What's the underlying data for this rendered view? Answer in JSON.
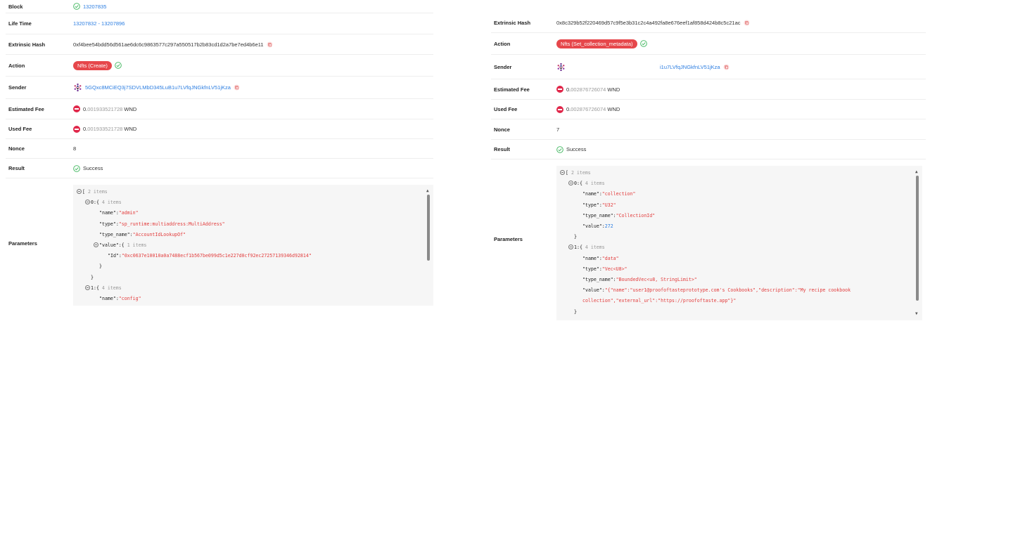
{
  "left": {
    "block": {
      "label": "Block",
      "value": "13207835"
    },
    "life_time": {
      "label": "Life Time",
      "value": "13207832 - 13207896"
    },
    "extrinsic_hash": {
      "label": "Extrinsic Hash",
      "value": "0xf4bee54bdd56d561ae6dc6c9863577c297a550517b2b83cd1d2a7be7ed4b6e11"
    },
    "action": {
      "label": "Action",
      "badge": "Nfts (Create)"
    },
    "sender": {
      "label": "Sender",
      "address": "5GQxc8MCiEQ3j7SDVLMbD345LuB1u7LVfqJNGkfnLV51jKza"
    },
    "estimated_fee": {
      "label": "Estimated Fee",
      "int": "0.",
      "dec": "001933521728",
      "unit": "WND"
    },
    "used_fee": {
      "label": "Used Fee",
      "int": "0.",
      "dec": "001933521728",
      "unit": "WND"
    },
    "nonce": {
      "label": "Nonce",
      "value": "8"
    },
    "result": {
      "label": "Result",
      "value": "Success"
    },
    "parameters": {
      "label": "Parameters",
      "lines": [
        {
          "indent": 0,
          "toggle": true,
          "text": "[",
          "meta": "2 items"
        },
        {
          "indent": 1,
          "toggle": true,
          "text": "0:",
          "brace": "{",
          "meta": "4 items"
        },
        {
          "indent": 2,
          "key": "\"name\":",
          "str": "\"admin\""
        },
        {
          "indent": 2,
          "key": "\"type\":",
          "str": "\"sp_runtime:multiaddress:MultiAddress\""
        },
        {
          "indent": 2,
          "key": "\"type_name\":",
          "str": "\"AccountIdLookupOf\""
        },
        {
          "indent": 2,
          "toggle": true,
          "key": "\"value\":",
          "brace": "{",
          "meta": "1 items"
        },
        {
          "indent": 3,
          "key": "\"Id\":",
          "str": "\"0xc0637e10010a0a7488ecf1b567be099d5c1e227d0cf92ec27257139346d92814\""
        },
        {
          "indent": 2,
          "text": "}"
        },
        {
          "indent": 1,
          "text": "}"
        },
        {
          "indent": 1,
          "toggle": true,
          "text": "1:",
          "brace": "{",
          "meta": "4 items"
        },
        {
          "indent": 2,
          "key": "\"name\":",
          "str": "\"config\""
        }
      ]
    }
  },
  "right": {
    "extrinsic_hash": {
      "label": "Extrinsic Hash",
      "value": "0x8c329b52f220469d57c9f5e3b31c2c4a492fa8e676eef1af858d424b8c5c21ac"
    },
    "action": {
      "label": "Action",
      "badge": "Nfts (Set_collection_metadata)"
    },
    "sender": {
      "label": "Sender",
      "address": "i1u7LVfqJNGkfnLV51jKza"
    },
    "estimated_fee": {
      "label": "Estimated Fee",
      "int": "0.",
      "dec": "002876726074",
      "unit": "WND"
    },
    "used_fee": {
      "label": "Used Fee",
      "int": "0.",
      "dec": "002876726074",
      "unit": "WND"
    },
    "nonce": {
      "label": "Nonce",
      "value": "7"
    },
    "result": {
      "label": "Result",
      "value": "Success"
    },
    "parameters": {
      "label": "Parameters",
      "lines": [
        {
          "indent": 0,
          "toggle": true,
          "text": "[",
          "meta": "2 items"
        },
        {
          "indent": 1,
          "toggle": true,
          "text": "0:",
          "brace": "{",
          "meta": "4 items"
        },
        {
          "indent": 2,
          "key": "\"name\":",
          "str": "\"collection\""
        },
        {
          "indent": 2,
          "key": "\"type\":",
          "str": "\"U32\""
        },
        {
          "indent": 2,
          "key": "\"type_name\":",
          "str": "\"CollectionId\""
        },
        {
          "indent": 2,
          "key": "\"value\":",
          "num": "272"
        },
        {
          "indent": 1,
          "text": "}"
        },
        {
          "indent": 1,
          "toggle": true,
          "text": "1:",
          "brace": "{",
          "meta": "4 items"
        },
        {
          "indent": 2,
          "key": "\"name\":",
          "str": "\"data\""
        },
        {
          "indent": 2,
          "key": "\"type\":",
          "str": "\"Vec<U8>\""
        },
        {
          "indent": 2,
          "key": "\"type_name\":",
          "str": "\"BoundedVec<u8, StringLimit>\""
        },
        {
          "indent": 2,
          "key": "\"value\":",
          "str": "\"{\"name\":\"user1@proofoftasteprototype.com's Cookbooks\",\"description\":\"My recipe cookbook"
        },
        {
          "indent": 2,
          "str": "collection\",\"external_url\":\"https://proofoftaste.app\"}\""
        },
        {
          "indent": 1,
          "text": "}"
        }
      ]
    }
  },
  "colors": {
    "link": "#2b7de1",
    "badge": "#e6474b",
    "success": "#3cb55b",
    "wnd": "#e0274a"
  },
  "icons": {
    "success": "check-circle-icon",
    "copy": "copy-icon",
    "token": "wnd-token-icon",
    "avatar": "identicon-avatar"
  }
}
